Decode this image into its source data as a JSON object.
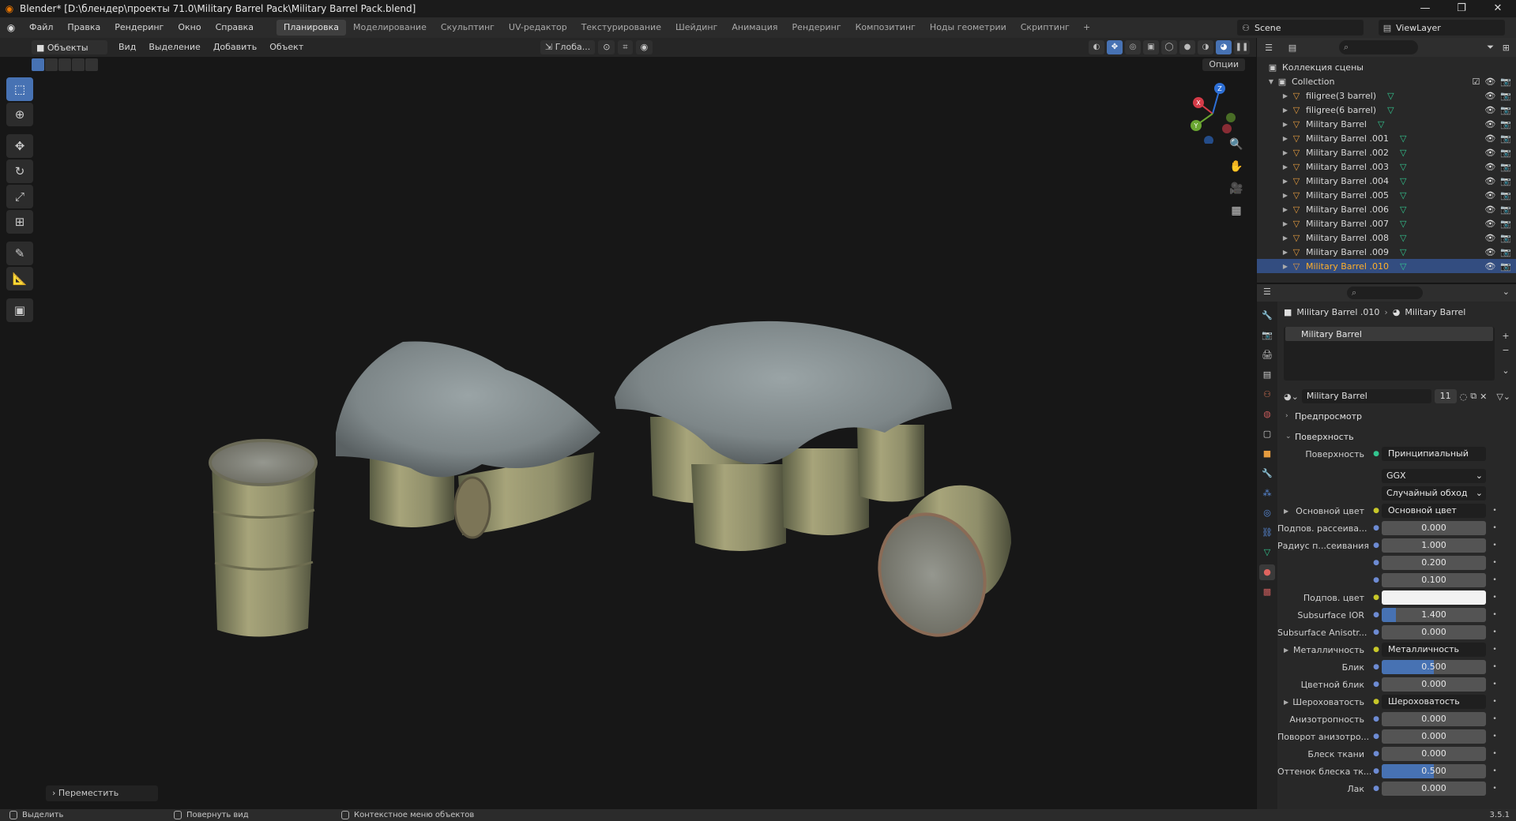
{
  "window": {
    "title": "Blender* [D:\\блендер\\проекты 71.0\\Military Barrel Pack\\Military Barrel Pack.blend]",
    "controls": [
      "—",
      "❐",
      "✕"
    ]
  },
  "menubar": {
    "items": [
      "Файл",
      "Правка",
      "Рендеринг",
      "Окно",
      "Справка"
    ],
    "workspaces": [
      "Планировка",
      "Моделирование",
      "Скульптинг",
      "UV-редактор",
      "Текстурирование",
      "Шейдинг",
      "Анимация",
      "Рендеринг",
      "Композитинг",
      "Ноды геометрии",
      "Скриптинг"
    ],
    "active_workspace": "Планировка",
    "add_workspace": "+",
    "scene": "Scene",
    "view_layer": "ViewLayer"
  },
  "viewport": {
    "mode": "Объекты",
    "menu": [
      "Вид",
      "Выделение",
      "Добавить",
      "Объект"
    ],
    "transform_orientation": "Глоба...",
    "options": "Опции",
    "last_operator": "Переместить",
    "gizmo_axes": [
      "X",
      "Y",
      "Z"
    ]
  },
  "outliner": {
    "root": "Коллекция сцены",
    "collection": "Collection",
    "objects": [
      "filigree(3 barrel)",
      "filigree(6 barrel)",
      "Military Barrel",
      "Military Barrel .001",
      "Military Barrel .002",
      "Military Barrel .003",
      "Military Barrel .004",
      "Military Barrel .005",
      "Military Barrel .006",
      "Military Barrel .007",
      "Military Barrel .008",
      "Military Barrel .009",
      "Military Barrel .010"
    ],
    "selected": "Military Barrel .010"
  },
  "properties": {
    "breadcrumb_object": "Military Barrel .010",
    "breadcrumb_material": "Military Barrel",
    "slot_material": "Military Barrel",
    "datablock_name": "Military Barrel",
    "datablock_users": "11",
    "panel_preview": "Предпросмотр",
    "panel_surface": "Поверхность",
    "surface_label": "Поверхность",
    "surface_value": "Принципиальный BSDF",
    "distribution": "GGX",
    "subsurface_method": "Случайный обход",
    "rows": [
      {
        "label": "Основной цвет",
        "value": "Основной цвет",
        "kind": "link",
        "expand": true
      },
      {
        "label": "Подпов. рассеива...",
        "value": "0.000",
        "kind": "num",
        "fill": 0
      },
      {
        "label": "Радиус п...сеивания",
        "value": "1.000",
        "kind": "num",
        "fill": 0
      },
      {
        "label": "",
        "value": "0.200",
        "kind": "num",
        "fill": 0
      },
      {
        "label": "",
        "value": "0.100",
        "kind": "num",
        "fill": 0
      },
      {
        "label": "Подпов. цвет",
        "value": "",
        "kind": "color"
      },
      {
        "label": "Subsurface IOR",
        "value": "1.400",
        "kind": "num",
        "fill": 0.14
      },
      {
        "label": "Subsurface Anisotr...",
        "value": "0.000",
        "kind": "num",
        "fill": 0
      },
      {
        "label": "Металличность",
        "value": "Металличность",
        "kind": "link",
        "expand": true
      },
      {
        "label": "Блик",
        "value": "0.500",
        "kind": "num",
        "fill": 0.5
      },
      {
        "label": "Цветной блик",
        "value": "0.000",
        "kind": "num",
        "fill": 0
      },
      {
        "label": "Шероховатость",
        "value": "Шероховатость",
        "kind": "link",
        "expand": true
      },
      {
        "label": "Анизотропность",
        "value": "0.000",
        "kind": "num",
        "fill": 0
      },
      {
        "label": "Поворот анизотро...",
        "value": "0.000",
        "kind": "num",
        "fill": 0
      },
      {
        "label": "Блеск ткани",
        "value": "0.000",
        "kind": "num",
        "fill": 0
      },
      {
        "label": "Оттенок блеска тк...",
        "value": "0.500",
        "kind": "num",
        "fill": 0.5
      },
      {
        "label": "Лак",
        "value": "0.000",
        "kind": "num",
        "fill": 0
      }
    ]
  },
  "statusbar": {
    "left": "Выделить",
    "middle": "Повернуть вид",
    "right": "Контекстное меню объектов",
    "version": "3.5.1"
  },
  "colors": {
    "accent": "#4772b3",
    "selected_text": "#ffaf29",
    "mesh_icon": "#33c58f",
    "object_icon": "#e59b3f"
  }
}
